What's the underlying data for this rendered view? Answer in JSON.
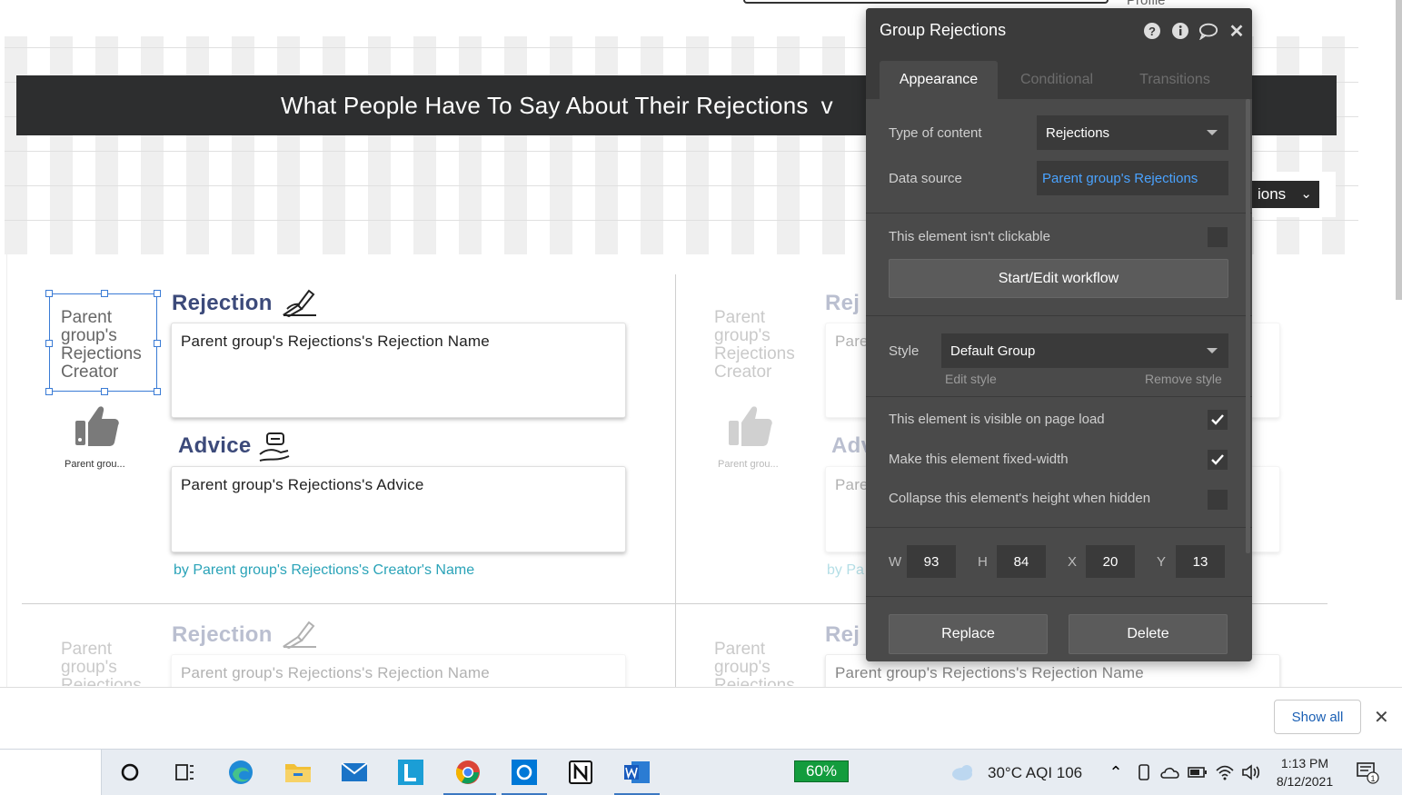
{
  "top": {
    "profile_label": "Profile"
  },
  "header": {
    "title": "What People Have To Say About Their Rejections",
    "title_tail": "v"
  },
  "behind_dropdown": {
    "label": "ions"
  },
  "cell": {
    "avatar_text": "Parent group's Rejections Creator",
    "avatar_text_cut": "Parent group's Rejection:",
    "thumb_caption": "Parent grou...",
    "rejection_heading": "Rejection",
    "rejection_value": "Parent group's Rejections's Rejection Name",
    "advice_heading": "Advice",
    "advice_value": "Parent group's Rejections's Advice",
    "by_line": "by Parent group's Rejections's Creator's Name",
    "rej_short": "Rej",
    "adv_short": "Adv",
    "pare_short": "Pare",
    "by_short": "by Pa",
    "avatar_short": "Parent group's Rejections Creator",
    "avatar_short_cut": "Parent group's"
  },
  "panel": {
    "title": "Group Rejections",
    "tabs": [
      "Appearance",
      "Conditional",
      "Transitions"
    ],
    "type_label": "Type of content",
    "type_value": "Rejections",
    "source_label": "Data source",
    "source_value": "Parent group's Rejections",
    "not_clickable_label": "This element isn't clickable",
    "workflow_button": "Start/Edit workflow",
    "style_label": "Style",
    "style_value": "Default Group",
    "edit_style": "Edit style",
    "remove_style": "Remove style",
    "visible_label": "This element is visible on page load",
    "fixed_width_label": "Make this element fixed-width",
    "collapse_label": "Collapse this element's height when hidden",
    "w_label": "W",
    "w_value": "93",
    "h_label": "H",
    "h_value": "84",
    "x_label": "X",
    "x_value": "20",
    "y_label": "Y",
    "y_value": "13",
    "replace_button": "Replace",
    "delete_button": "Delete"
  },
  "download_bar": {
    "show_all": "Show all"
  },
  "taskbar": {
    "battery": "60%",
    "weather": "30°C  AQI 106",
    "time": "1:13 PM",
    "date": "8/12/2021"
  },
  "colors": {
    "accent_blue": "#3a7bd5",
    "heading_navy": "#3c4a7a",
    "byline_teal": "#2aa3b8",
    "panel_bg": "#4a4a4a",
    "link_blue": "#4aa3ff"
  }
}
